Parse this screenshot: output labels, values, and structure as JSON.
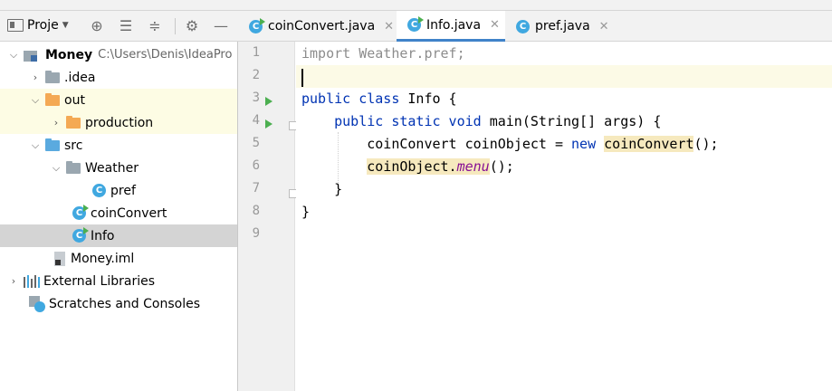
{
  "project_panel": {
    "title": "Proje",
    "tree": [
      {
        "label": "Money",
        "path": "C:\\Users\\Denis\\IdeaPro",
        "expanded": true
      },
      {
        "label": ".idea",
        "expanded": false
      },
      {
        "label": "out",
        "expanded": true
      },
      {
        "label": "production",
        "expanded": false
      },
      {
        "label": "src",
        "expanded": true
      },
      {
        "label": "Weather",
        "expanded": true
      },
      {
        "label": "pref"
      },
      {
        "label": "coinConvert"
      },
      {
        "label": "Info",
        "selected": true
      },
      {
        "label": "Money.iml"
      },
      {
        "label": "External Libraries",
        "expanded": false
      },
      {
        "label": "Scratches and Consoles"
      }
    ]
  },
  "editor": {
    "tabs": [
      {
        "label": "coinConvert.java",
        "active": false
      },
      {
        "label": "Info.java",
        "active": true
      },
      {
        "label": "pref.java",
        "active": false
      }
    ],
    "line_numbers": [
      "1",
      "2",
      "3",
      "4",
      "5",
      "6",
      "7",
      "8",
      "9"
    ],
    "code": {
      "l1": "import Weather.pref;",
      "l3_kw": "public class ",
      "l3_rest": "Info {",
      "l4_kw": "    public static void ",
      "l4_rest": "main(String[] args) {",
      "l5_a": "        coinConvert coinObject = ",
      "l5_kw": "new ",
      "l5_hl": "coinConvert",
      "l5_end": "();",
      "l6_hl1": "coinObject.",
      "l6_it": "menu",
      "l6_end": "();",
      "l6_indent": "        ",
      "l7": "    }",
      "l8": "}"
    }
  },
  "colors": {
    "keyword": "#0033b3",
    "accent": "#4083c9",
    "selection": "#d4d4d4",
    "run_marker": "#4caf50"
  },
  "icons": [
    "panel-icon",
    "locate-icon",
    "expand-all-icon",
    "collapse-all-icon",
    "gear-icon",
    "minimize-icon",
    "chevron-right-icon",
    "chevron-down-icon",
    "folder-icon",
    "class-icon",
    "module-icon",
    "library-icon",
    "scratch-icon",
    "close-icon",
    "run-icon"
  ]
}
